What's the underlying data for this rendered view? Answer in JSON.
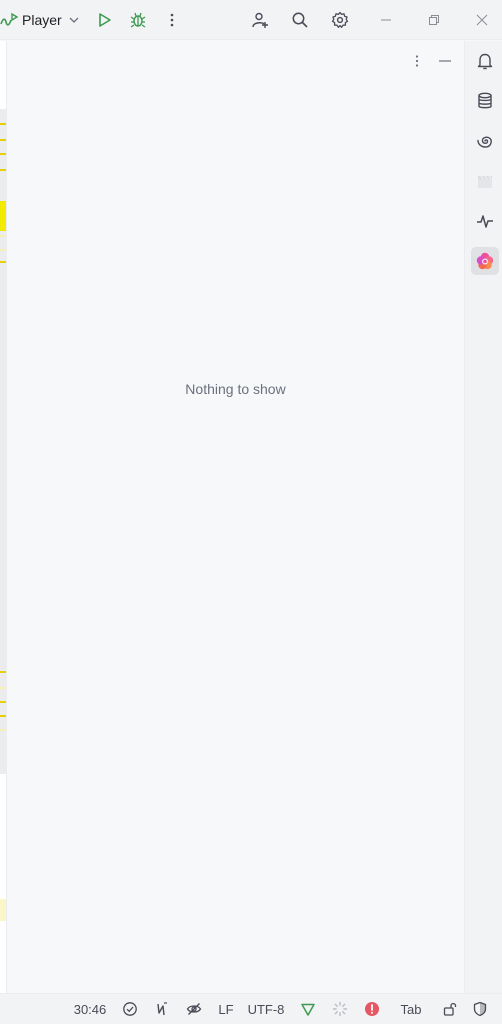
{
  "titlebar": {
    "run_config": {
      "label": "Player",
      "icon": "run-config-icon"
    },
    "buttons": [
      {
        "name": "run-button",
        "icon": "play-icon",
        "color": "#3d9a50"
      },
      {
        "name": "debug-button",
        "icon": "bug-icon",
        "color": "#3d9a50"
      },
      {
        "name": "more-actions-button",
        "icon": "more-vertical-icon"
      },
      {
        "name": "code-with-me-button",
        "icon": "add-user-icon"
      },
      {
        "name": "search-everywhere-button",
        "icon": "search-icon"
      },
      {
        "name": "settings-button",
        "icon": "gear-icon"
      }
    ],
    "window_controls": [
      "minimize",
      "restore",
      "close"
    ]
  },
  "tool_window": {
    "empty_message": "Nothing to show",
    "actions": [
      "more-options",
      "hide"
    ]
  },
  "right_strip": {
    "items": [
      {
        "name": "notifications",
        "icon": "bell-icon"
      },
      {
        "name": "database",
        "icon": "database-icon"
      },
      {
        "name": "ai-assistant",
        "icon": "spiral-icon"
      },
      {
        "name": "media",
        "icon": "clapperboard-icon"
      },
      {
        "name": "profiler",
        "icon": "pulse-icon"
      },
      {
        "name": "ai-plugin",
        "icon": "flower-icon",
        "active": true
      }
    ]
  },
  "statusbar": {
    "position": "30:46",
    "line_separator": "LF",
    "encoding": "UTF-8",
    "indent": "Tab",
    "colors": {
      "error": "#e55765",
      "vcs": "#3d9a50"
    }
  }
}
